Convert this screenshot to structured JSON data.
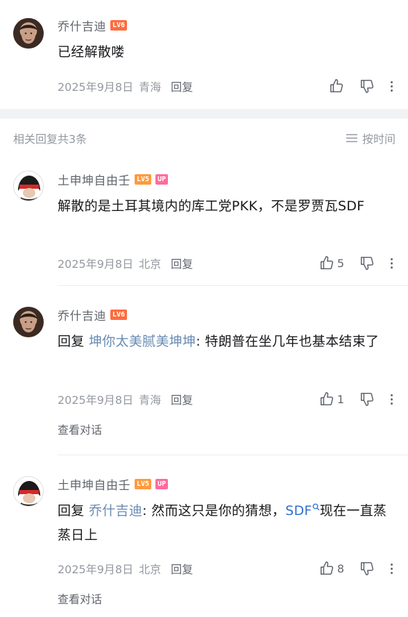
{
  "top_comment": {
    "user": "乔什吉迪",
    "level": "LV6",
    "text": "已经解散喽",
    "date": "2025年9月8日",
    "location": "青海",
    "reply_label": "回复"
  },
  "replies_header": {
    "count_text": "相关回复共3条",
    "sort_label": "按时间"
  },
  "replies": [
    {
      "user": "土申坤自由壬",
      "level": "LV5",
      "up_badge": "UP",
      "text": "解散的是土耳其境内的库工党PKK，不是罗贾瓦SDF",
      "date": "2025年9月8日",
      "location": "北京",
      "reply_label": "回复",
      "likes": "5"
    },
    {
      "user": "乔什吉迪",
      "level": "LV6",
      "reply_prefix": "回复",
      "mention": "坤你太美腻美坤坤",
      "text": ": 特朗普在坐几年也基本结束了",
      "date": "2025年9月8日",
      "location": "青海",
      "reply_label": "回复",
      "likes": "1",
      "view_convo": "查看对话"
    },
    {
      "user": "土申坤自由壬",
      "level": "LV5",
      "up_badge": "UP",
      "reply_prefix": "回复",
      "mention": "乔什吉迪",
      "text_a": ": 然而这只是你的猜想，",
      "link": "SDF",
      "text_b": "现在一直蒸蒸日上",
      "date": "2025年9月8日",
      "location": "北京",
      "reply_label": "回复",
      "likes": "8",
      "view_convo": "查看对话"
    }
  ],
  "icons": [
    "thumbs-up-icon",
    "thumbs-down-icon",
    "more-icon",
    "sort-icon",
    "search-icon"
  ]
}
